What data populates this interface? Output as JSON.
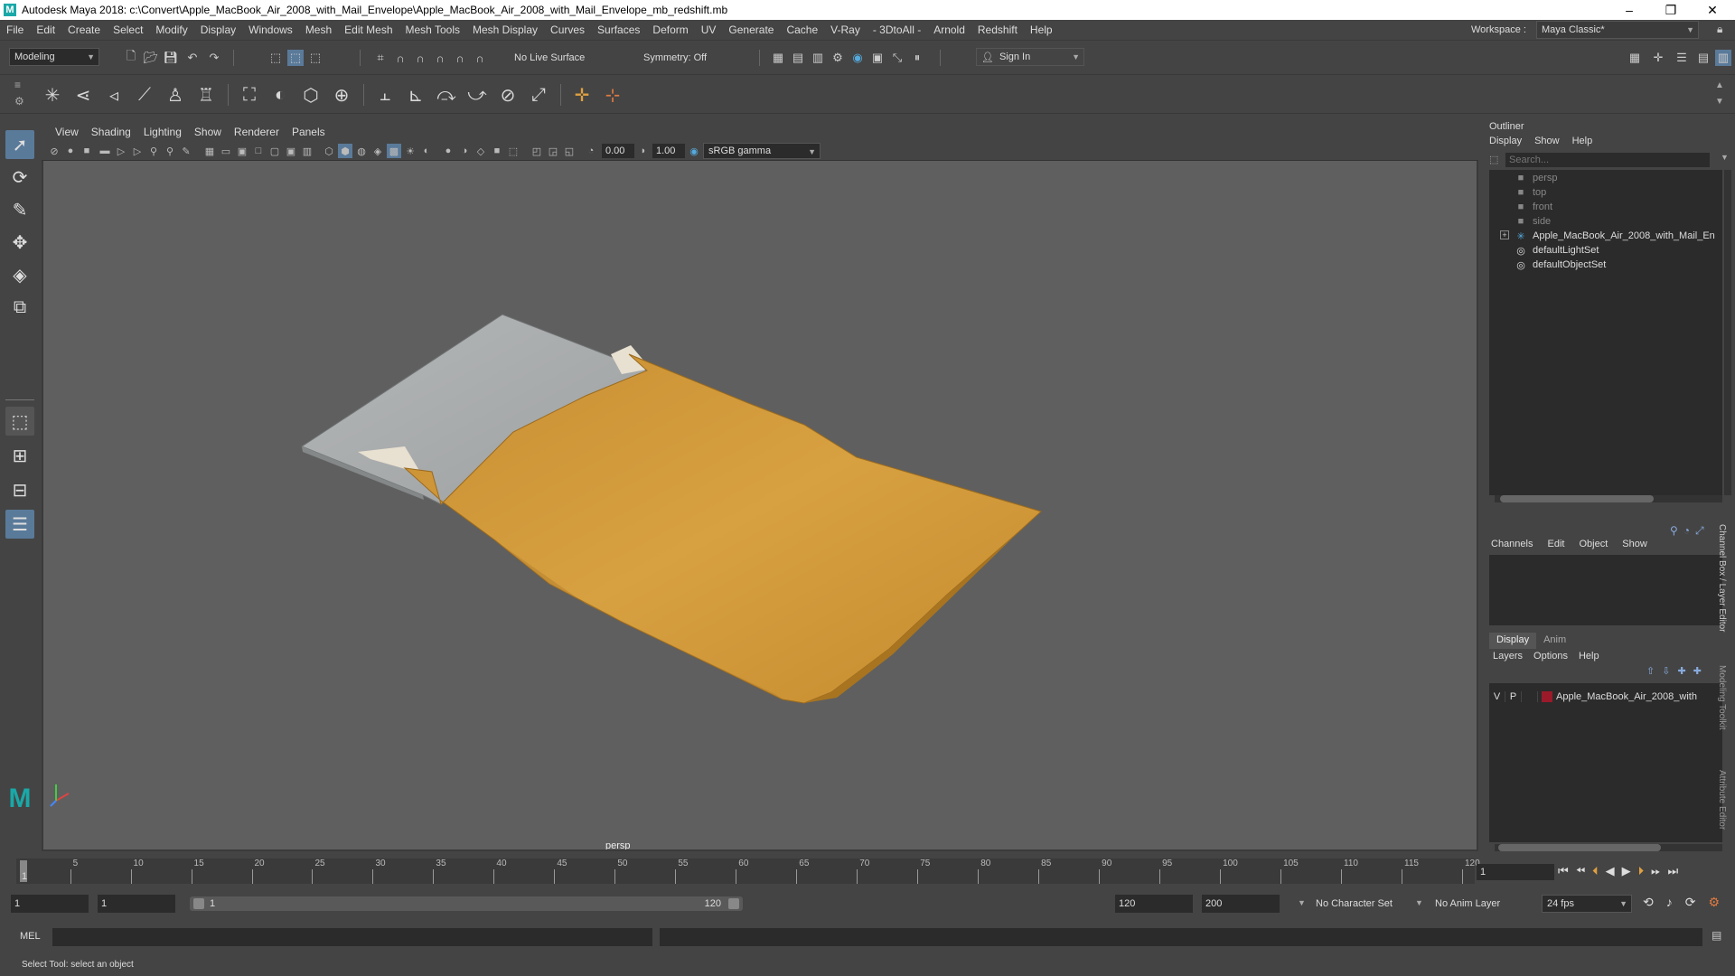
{
  "window": {
    "title": "Autodesk Maya 2018: c:\\Convert\\Apple_MacBook_Air_2008_with_Mail_Envelope\\Apple_MacBook_Air_2008_with_Mail_Envelope_mb_redshift.mb",
    "logo_letter": "M",
    "minimize": "–",
    "maximize": "❐",
    "close": "✕"
  },
  "menubar": {
    "items": [
      "File",
      "Edit",
      "Create",
      "Select",
      "Modify",
      "Display",
      "Windows",
      "Mesh",
      "Edit Mesh",
      "Mesh Tools",
      "Mesh Display",
      "Curves",
      "Surfaces",
      "Deform",
      "UV",
      "Generate",
      "Cache",
      "V-Ray",
      "- 3DtoAll -",
      "Arnold",
      "Redshift",
      "Help"
    ],
    "workspace_label": "Workspace :",
    "workspace_value": "Maya Classic*"
  },
  "statusline": {
    "mode": "Modeling",
    "live_surface": "No Live Surface",
    "symmetry": "Symmetry: Off",
    "sign_in": "Sign In"
  },
  "viewpanel": {
    "menu": [
      "View",
      "Shading",
      "Lighting",
      "Show",
      "Renderer",
      "Panels"
    ],
    "exposure": "0.00",
    "gamma": "1.00",
    "color_space": "sRGB gamma",
    "camera_label": "persp"
  },
  "outliner": {
    "title": "Outliner",
    "menu": [
      "Display",
      "Show",
      "Help"
    ],
    "search_placeholder": "Search...",
    "items": [
      {
        "label": "persp",
        "type": "camera",
        "dim": true
      },
      {
        "label": "top",
        "type": "camera",
        "dim": true
      },
      {
        "label": "front",
        "type": "camera",
        "dim": true
      },
      {
        "label": "side",
        "type": "camera",
        "dim": true
      },
      {
        "label": "Apple_MacBook_Air_2008_with_Mail_En",
        "type": "group",
        "dim": false
      },
      {
        "label": "defaultLightSet",
        "type": "set",
        "dim": false
      },
      {
        "label": "defaultObjectSet",
        "type": "set",
        "dim": false
      }
    ]
  },
  "channelbox": {
    "menu": [
      "Channels",
      "Edit",
      "Object",
      "Show"
    ],
    "tabs": [
      "Display",
      "Anim"
    ],
    "layer_menu": [
      "Layers",
      "Options",
      "Help"
    ],
    "layer": {
      "v": "V",
      "p": "P",
      "name": "Apple_MacBook_Air_2008_with",
      "color": "#9a1a2a"
    },
    "side_tabs": [
      "Channel Box / Layer Editor",
      "Modeling Toolkit",
      "Attribute Editor"
    ]
  },
  "timeline": {
    "ticks": [
      "5",
      "10",
      "15",
      "20",
      "25",
      "30",
      "35",
      "40",
      "45",
      "50",
      "55",
      "60",
      "65",
      "70",
      "75",
      "80",
      "85",
      "90",
      "95",
      "100",
      "105",
      "110",
      "115",
      "120"
    ],
    "start_marker": "1",
    "current_frame": "1"
  },
  "range": {
    "start": "1",
    "playback_start": "1",
    "slider_start": "1",
    "slider_end": "120",
    "playback_end": "120",
    "end": "200",
    "character_set": "No Character Set",
    "anim_layer": "No Anim Layer",
    "fps": "24 fps"
  },
  "command": {
    "label": "MEL"
  },
  "helpline": {
    "text": "Select Tool: select an object"
  },
  "colors": {
    "envelope": "#d39a3a",
    "laptop": "#a9acad",
    "viewport_bg": "#5f5f5f",
    "accent_blue": "#5aa0d8"
  }
}
